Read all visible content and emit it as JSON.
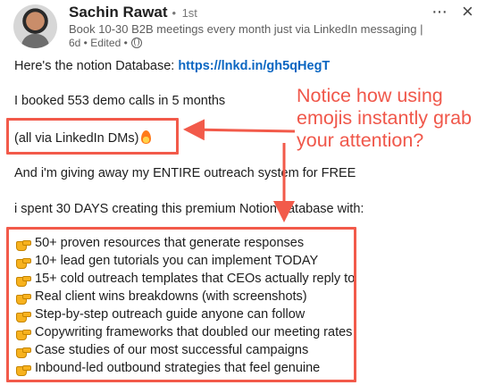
{
  "post": {
    "author": {
      "name": "Sachin Rawat",
      "dot": "•",
      "degree": "1st",
      "headline": "Book 10-30 B2B meetings every month just via LinkedIn messaging | Gr...",
      "meta": "6d • Edited •"
    },
    "actions": {
      "more_label": "···",
      "close_label": "×"
    },
    "body": {
      "intro_prefix": "Here's the notion Database: ",
      "intro_link": "https://lnkd.in/gh5qHegT",
      "booked": "I booked 553 demo calls in 5 months",
      "via": "(all via LinkedIn DMs)",
      "giveaway": "And i'm giving away my ENTIRE outreach system for FREE",
      "spent": "i spent 30 DAYS creating this premium Notion database with:",
      "list_items": [
        "50+ proven resources that generate responses",
        "10+ lead gen tutorials you can implement TODAY",
        "15+ cold outreach templates that CEOs actually reply to",
        "Real client wins breakdowns (with screenshots)",
        "Step-by-step outreach guide anyone can follow",
        "Copywriting frameworks that doubled our meeting rates",
        "Case studies of our most successful campaigns",
        "Inbound-led outbound strategies that feel genuine"
      ]
    }
  },
  "annotation": {
    "callout_text": "Notice how using emojis instantly grab your attention?",
    "color": "#f25a4a"
  },
  "icons": {
    "globe": "globe-icon",
    "fire": "fire-icon",
    "hand": "backhand-index-pointing-right-icon",
    "more": "more-options-icon",
    "close": "close-icon"
  }
}
